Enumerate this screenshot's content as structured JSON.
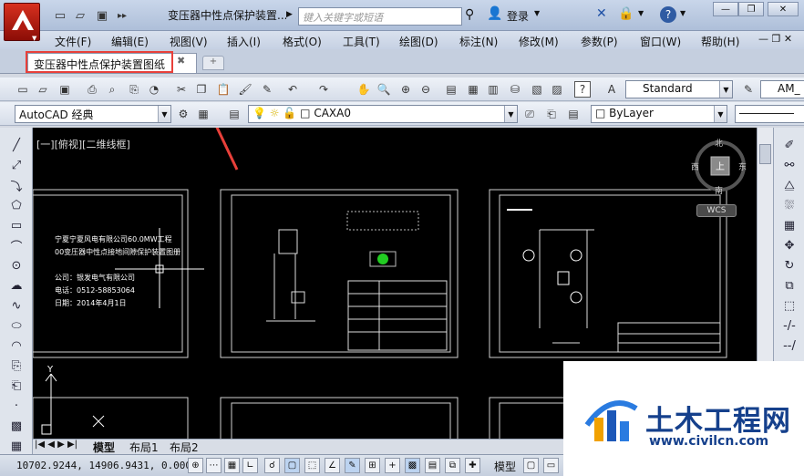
{
  "title_bar": {
    "window_title": "变压器中性点保护装置...",
    "search_placeholder": "键入关键字或短语",
    "login": "登录",
    "minimize": "—",
    "restore": "❐",
    "close": "✕"
  },
  "menu": [
    "文件(F)",
    "编辑(E)",
    "视图(V)",
    "插入(I)",
    "格式(O)",
    "工具(T)",
    "绘图(D)",
    "标注(N)",
    "修改(M)",
    "参数(P)",
    "窗口(W)",
    "帮助(H)"
  ],
  "tabs": {
    "document_tab": "变压器中性点保护装置图纸"
  },
  "toolbar": {
    "text_style": "Standard",
    "dim_style_partial": "AM_",
    "workspace": "AutoCAD 经典",
    "layer": "CAXA0",
    "color": "ByLayer"
  },
  "viewport": {
    "label": "[一][俯视][二维线框]",
    "compass_n": "北",
    "compass_s": "南",
    "compass_e": "东",
    "compass_w": "西",
    "compass_top": "上",
    "wcs": "WCS",
    "ucs_y": "Y"
  },
  "drawing_text": {
    "line1": "宁夏宁夏风电有限公司60.0MW工程",
    "line2": "00变压器中性点接地间隙保护装置图册",
    "line3": "公司：银发电气有限公司",
    "line4": "电话：0512-58853064",
    "line5": "日期：2014年4月1日"
  },
  "layout_tabs": [
    "模型",
    "布局1",
    "布局2"
  ],
  "status": {
    "coords": "10702.9244, 14906.9431, 0.0000",
    "model": "模型"
  },
  "watermark": {
    "title": "土木工程网",
    "url": "www.civilcn.com"
  }
}
